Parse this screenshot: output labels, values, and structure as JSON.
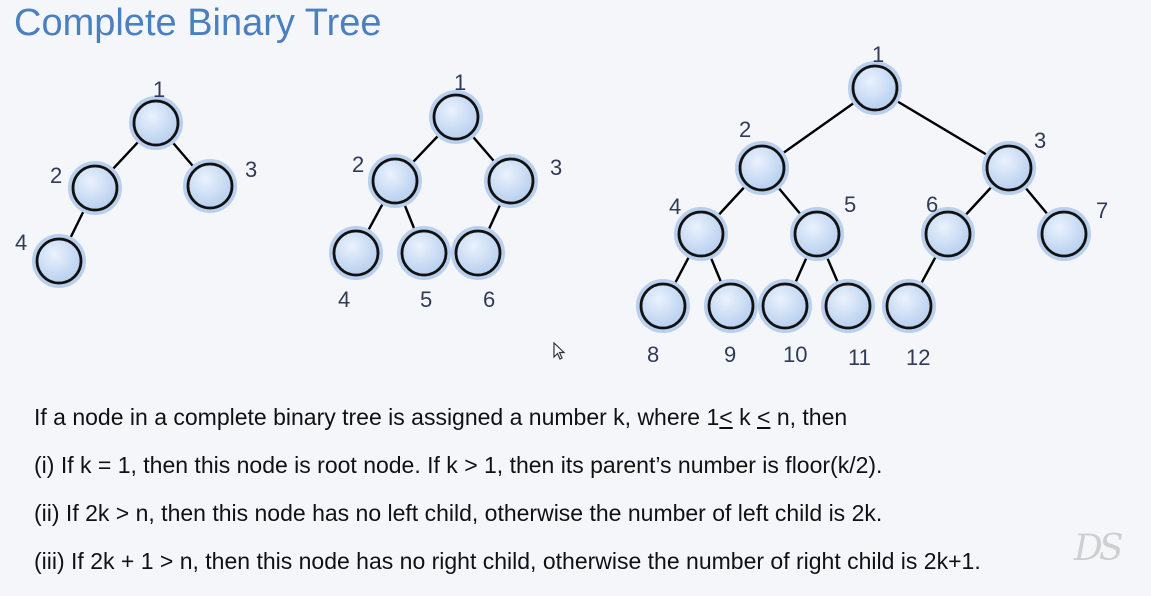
{
  "slide": {
    "title": "Complete Binary Tree"
  },
  "watermark": "DS",
  "trees": [
    {
      "labels": [
        "1",
        "2",
        "3",
        "4"
      ],
      "edges": [
        [
          "1",
          "2"
        ],
        [
          "1",
          "3"
        ],
        [
          "2",
          "4"
        ]
      ]
    },
    {
      "labels": [
        "1",
        "2",
        "3",
        "4",
        "5",
        "6"
      ],
      "edges": [
        [
          "1",
          "2"
        ],
        [
          "1",
          "3"
        ],
        [
          "2",
          "4"
        ],
        [
          "2",
          "5"
        ],
        [
          "3",
          "6"
        ]
      ]
    },
    {
      "labels": [
        "1",
        "2",
        "3",
        "4",
        "5",
        "6",
        "7",
        "8",
        "9",
        "10",
        "11",
        "12"
      ],
      "edges": [
        [
          "1",
          "2"
        ],
        [
          "1",
          "3"
        ],
        [
          "2",
          "4"
        ],
        [
          "2",
          "5"
        ],
        [
          "3",
          "6"
        ],
        [
          "3",
          "7"
        ],
        [
          "4",
          "8"
        ],
        [
          "4",
          "9"
        ],
        [
          "5",
          "10"
        ],
        [
          "5",
          "11"
        ],
        [
          "6",
          "12"
        ]
      ]
    }
  ],
  "rules": {
    "intro": {
      "pre": "If a node in a complete binary tree is assigned a number k, where 1",
      "le1": "<",
      "mid": " k ",
      "le2": "<",
      "post": " n, then"
    },
    "rule1": "(i) If k = 1, then this node is root node. If k > 1, then its parent’s number is floor(k/2).",
    "rule2": "(ii) If 2k > n, then this node has no left child, otherwise the number of left child is 2k.",
    "rule3": "(iii) If 2k + 1 > n, then this node has no right child, otherwise the number of right child is 2k+1."
  },
  "colors": {
    "title": "#4a7fc0",
    "node_fill": "#cfe0f7",
    "node_stroke": "#111111",
    "label": "#2f3b57"
  },
  "icons": {
    "cursor": "mouse-pointer-icon"
  }
}
